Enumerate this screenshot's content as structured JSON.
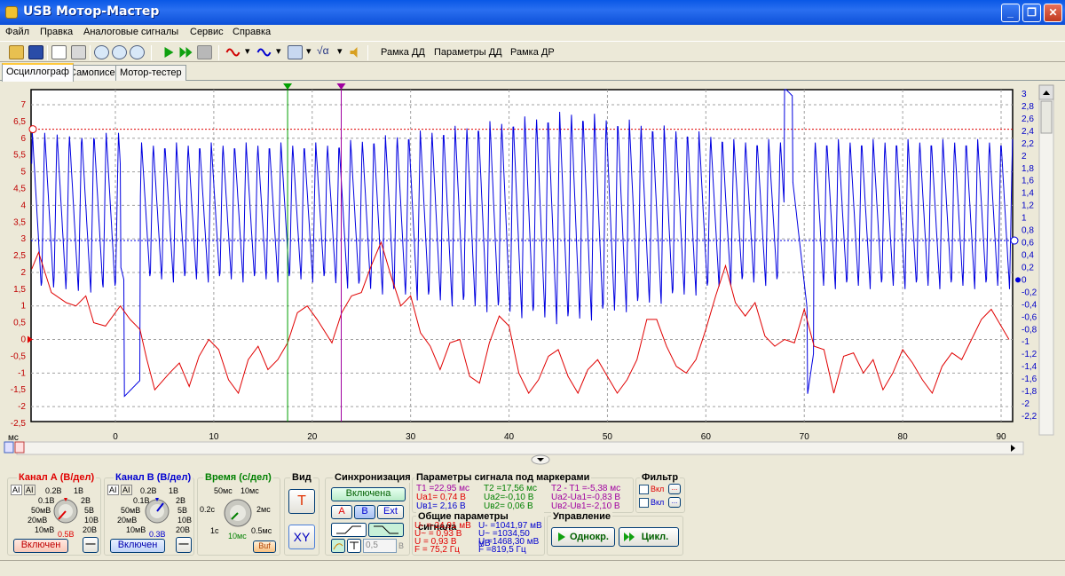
{
  "window": {
    "title": "USB Мотор-Мастер"
  },
  "menu": [
    "Файл",
    "Правка",
    "Аналоговые сигналы",
    "Сервис",
    "Справка"
  ],
  "toolbar": {
    "frame_dd": "Рамка ДД",
    "params_dd": "Параметры ДД",
    "frame_dr": "Рамка ДР"
  },
  "tabs": [
    "Осциллограф",
    "Самописец",
    "Мотор-тестер"
  ],
  "scope": {
    "left_axis_ticks": [
      "7",
      "6,5",
      "6",
      "5,5",
      "5",
      "4,5",
      "4",
      "3,5",
      "3",
      "2,5",
      "2",
      "1,5",
      "1",
      "0,5",
      "0",
      "-0,5",
      "-1",
      "-1,5",
      "-2",
      "-2,5"
    ],
    "right_axis_ticks": [
      "3",
      "2,8",
      "2,6",
      "2,4",
      "2,2",
      "2",
      "1,8",
      "1,6",
      "1,4",
      "1,2",
      "1",
      "0,8",
      "0,6",
      "0,4",
      "0,2",
      "0",
      "-0,2",
      "-0,4",
      "-0,6",
      "-0,8",
      "-1",
      "-1,2",
      "-1,4",
      "-1,6",
      "-1,8",
      "-2",
      "-2,2"
    ],
    "x_ticks": [
      "0",
      "10",
      "20",
      "30",
      "40",
      "50",
      "60",
      "70",
      "80",
      "90"
    ],
    "x_unit": "мс",
    "marker1_ms": 17.5,
    "marker2_ms": 22.95,
    "colors": {
      "chA": "#e00000",
      "chB": "#0000e0",
      "marker1": "#00a000",
      "marker2": "#a000a0"
    }
  },
  "chA": {
    "title": "Канал А (В/дел)",
    "labels": [
      "0.2В",
      "1В",
      "0.1В",
      "2В",
      "50мВ",
      "5В",
      "20мВ",
      "10В",
      "10мВ",
      "20В"
    ],
    "value": "0.5В",
    "button": "Включен",
    "minus": "—"
  },
  "chB": {
    "title": "Канал В (В/дел)",
    "labels": [
      "0.2В",
      "1В",
      "0.1В",
      "2В",
      "50мВ",
      "5В",
      "20мВ",
      "10В",
      "10мВ",
      "20В"
    ],
    "value": "0.3В",
    "button": "Включен",
    "minus": "—"
  },
  "time": {
    "title": "Время (с/дел)",
    "labels": [
      "50мс",
      "10мс",
      "0.2с",
      "2мс",
      "1с",
      "0.5мс"
    ],
    "value": "10мс",
    "buf": "Buf"
  },
  "view": {
    "title": "Вид",
    "t": "T",
    "xy": "XY"
  },
  "sync": {
    "title": "Синхронизация",
    "enabled": "Включена",
    "a": "A",
    "b": "B",
    "ext": "Ext",
    "level": "0,5",
    "unit": "В"
  },
  "marker_params": {
    "title": "Параметры сигнала под маркерами",
    "t1": "T1 =22,95 мс",
    "ua1": "Uа1= 0,74 В",
    "ub1": "Uв1= 2,16 В",
    "t2": "T2 =17,56 мс",
    "ua2": "Uа2=-0,10 В",
    "ub2": "Uв2= 0,06 В",
    "dt": "T2 - T1 =-5,38 мс",
    "dua": "Uа2-Uа1=-0,83 В",
    "dub": "Uв2-Uв1=-2,10 В"
  },
  "general": {
    "title": "Общие параметры сигнала",
    "a": [
      "U- =-24,91 мВ",
      "U~ = 0,93 В",
      "U = 0,93 В",
      "F = 75,2 Гц"
    ],
    "b": [
      "U- =1041,97 мВ",
      "U~ =1034,50 мВ",
      "U =1468,30 мВ",
      "F =819,5 Гц"
    ]
  },
  "filter": {
    "title": "Фильтр",
    "on": "Вкл",
    "dots": "..."
  },
  "control": {
    "title": "Управление",
    "single": "Однокр.",
    "cycle": "Цикл."
  }
}
